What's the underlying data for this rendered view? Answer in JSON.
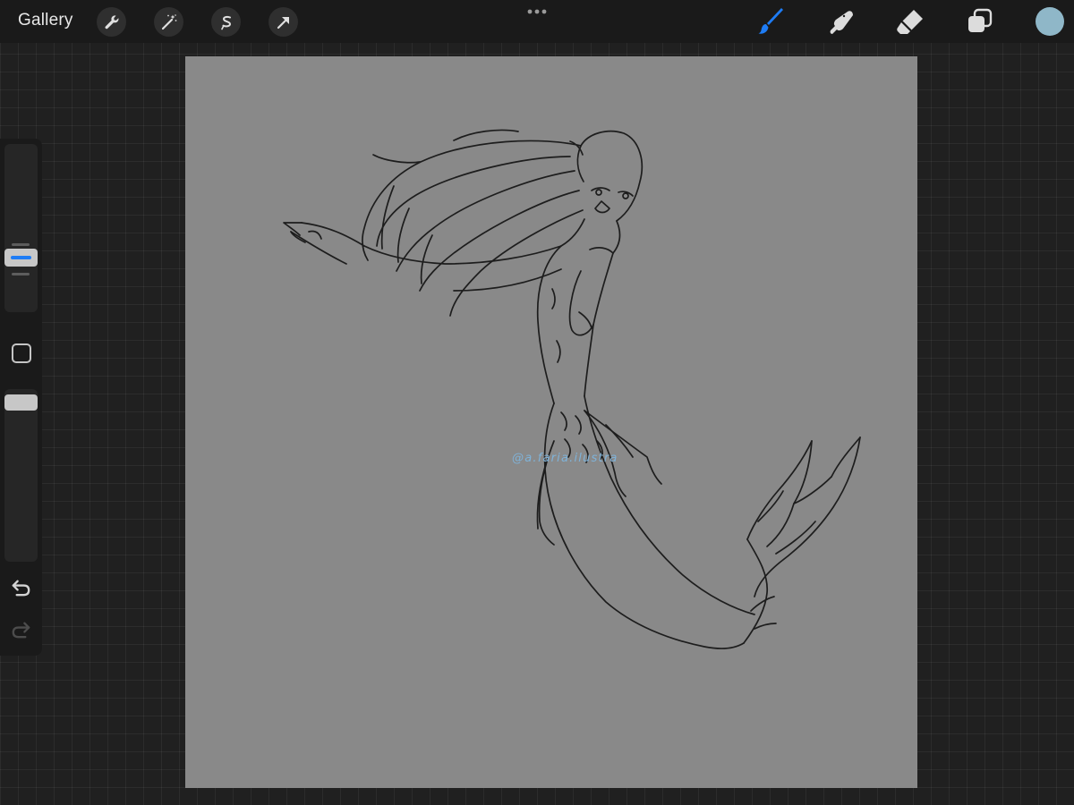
{
  "topbar": {
    "gallery_label": "Gallery",
    "left_tools": [
      "wrench-icon",
      "magic-wand-icon",
      "selection-icon",
      "transform-arrow-icon"
    ],
    "center": "more-dots-icon",
    "right_tools": [
      "brush-icon",
      "smudge-icon",
      "eraser-icon",
      "layers-icon"
    ],
    "current_color": "#8fb7c8",
    "active_tool": "brush",
    "accent_color": "#1e7cf5"
  },
  "canvas": {
    "background": "#898989",
    "watermark": "@a.faria.ilustra",
    "watermark_color": "#7fb2d8",
    "subject": "mermaid line sketch"
  },
  "sidebar": {
    "items": [
      "brush-size-slider",
      "modify-button",
      "opacity-slider",
      "undo-icon",
      "redo-icon"
    ]
  }
}
